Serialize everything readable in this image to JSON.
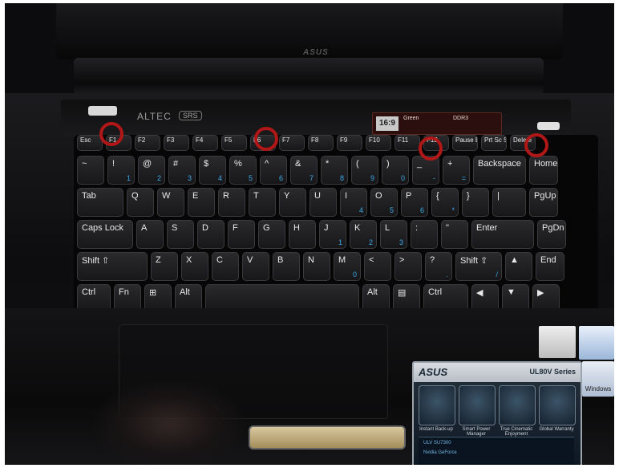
{
  "laptop": {
    "screen_brand": "ASUS",
    "speaker_brand": "ALTEC",
    "srs_badge": "SRS",
    "sticker_top": {
      "badge": "16:9",
      "line1": "Green",
      "line2": "DDR3"
    },
    "series": "UL80V Series",
    "sticker_brand": "ASUS",
    "features": [
      "Instant Back-up",
      "Smart Power Manager",
      "True Cinematic Enjoyment",
      "Global Warranty"
    ],
    "sticker_bottom": [
      "ULV SU7300",
      "Nvidia GeForce"
    ],
    "windows_label": "Windows",
    "marker_color": "#b11717",
    "keys": {
      "f": [
        "Esc",
        "F1",
        "F2",
        "F3",
        "F4",
        "F5",
        "F6",
        "F7",
        "F8",
        "F9",
        "F10",
        "F11",
        "F12",
        "Pause Break",
        "Prt Sc SysRq",
        "Delete"
      ],
      "r1": [
        "~",
        "!",
        "@",
        "#",
        "$",
        "%",
        "^",
        "&",
        "*",
        "(",
        ")",
        "_",
        "+",
        "Backspace",
        "Home"
      ],
      "r1sub": [
        "",
        "1",
        "2",
        "3",
        "4",
        "5",
        "6",
        "7",
        "8",
        "9",
        "0",
        "-",
        "=",
        "",
        ""
      ],
      "r2": [
        "Tab",
        "Q",
        "W",
        "E",
        "R",
        "T",
        "Y",
        "U",
        "I",
        "O",
        "P",
        "{",
        "}",
        "|",
        "PgUp"
      ],
      "r2sub": [
        "",
        "",
        "",
        "",
        "",
        "",
        "",
        "",
        "4",
        "5",
        "6",
        "*",
        "",
        "",
        ""
      ],
      "r3": [
        "Caps Lock",
        "A",
        "S",
        "D",
        "F",
        "G",
        "H",
        "J",
        "K",
        "L",
        ":",
        "\"",
        "Enter",
        "PgDn"
      ],
      "r3sub": [
        "",
        "",
        "",
        "",
        "",
        "",
        "",
        "1",
        "2",
        "3",
        "",
        "",
        "",
        ""
      ],
      "r4": [
        "Shift ⇧",
        "Z",
        "X",
        "C",
        "V",
        "B",
        "N",
        "M",
        "<",
        ">",
        "?",
        "Shift ⇧",
        "▲",
        "End"
      ],
      "r4sub": [
        "",
        "",
        "",
        "",
        "",
        "",
        "",
        "0",
        "",
        "",
        ".",
        "/",
        "",
        ""
      ],
      "r5": [
        "Ctrl",
        "Fn",
        "⊞",
        "Alt",
        "",
        "Alt",
        "▤",
        "Ctrl",
        "◀",
        "▼",
        "▶"
      ]
    }
  }
}
